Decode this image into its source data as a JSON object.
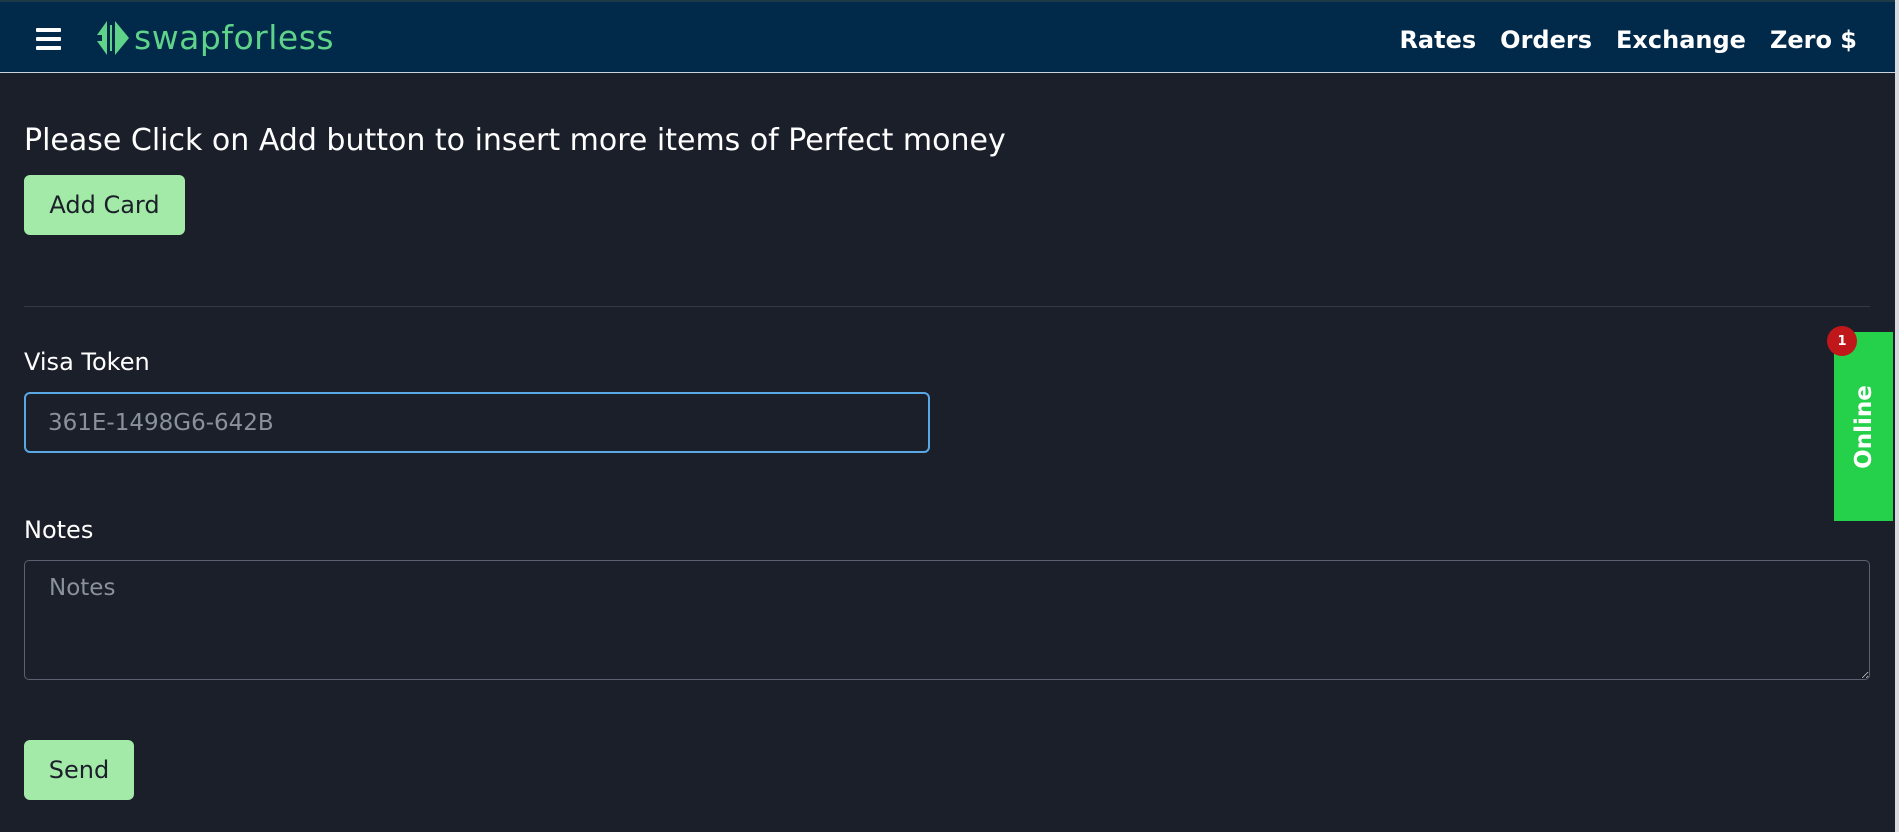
{
  "header": {
    "brand": "swapforless",
    "nav": [
      "Rates",
      "Orders",
      "Exchange",
      "Zero $"
    ]
  },
  "main": {
    "instruction": "Please Click on Add button to insert more items of Perfect money",
    "add_button": "Add Card",
    "visa_label": "Visa Token",
    "visa_placeholder": "361E-1498G6-642B",
    "notes_label": "Notes",
    "notes_placeholder": "Notes",
    "send_button": "Send"
  },
  "widget": {
    "online_label": "Online",
    "badge_count": "1"
  },
  "colors": {
    "background": "#1b1f2a",
    "header": "#00294a",
    "brand": "#5fd38a",
    "button": "#a3e9a7",
    "focus_border": "#5aa7e6",
    "online": "#25d04a",
    "badge": "#c0171b"
  }
}
